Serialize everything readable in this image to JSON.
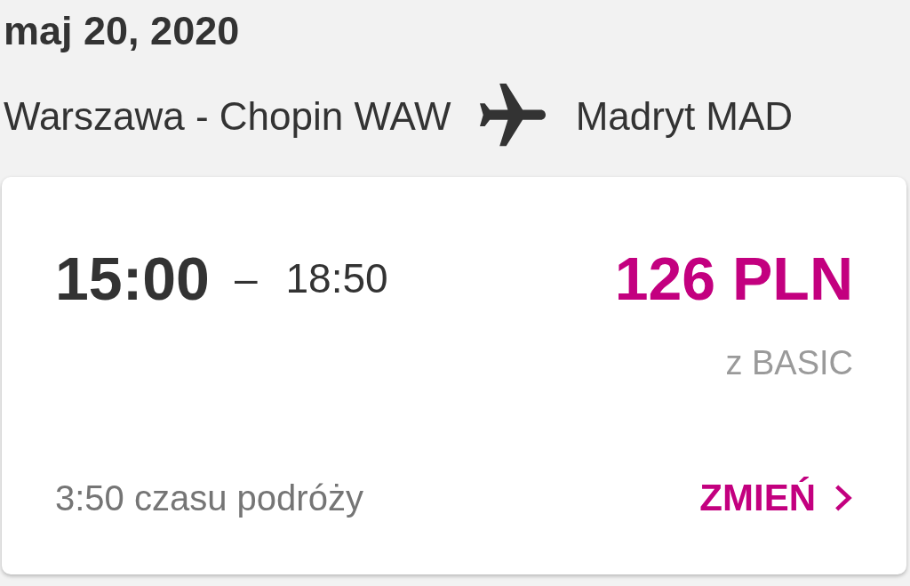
{
  "date": "maj 20, 2020",
  "route": {
    "origin": "Warszawa - Chopin WAW",
    "destination": "Madryt MAD"
  },
  "flight": {
    "departure": "15:00",
    "separator": "–",
    "arrival": "18:50",
    "price": "126 PLN",
    "fare": "z BASIC",
    "duration": "3:50 czasu podróży",
    "change_button": "ZMIEŃ"
  }
}
